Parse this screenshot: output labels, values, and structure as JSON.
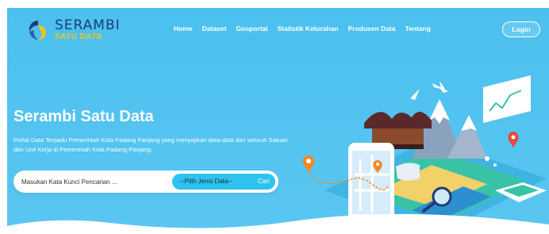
{
  "brand": {
    "title": "SERAMBI",
    "subtitle": "SATU DATA"
  },
  "nav": [
    "Home",
    "Dataset",
    "Geoportal",
    "Statistik Kelurahan",
    "Produsen Data",
    "Tentang"
  ],
  "login_label": "Login",
  "hero": {
    "title": "Serambi Satu Data",
    "description": "Portal Data Terpadu Pemerintah Kota Padang Panjang yang menyajikan data-data dari seluruh Satuan dan Unit Kerja di Pemerintah Kota Padang Panjang."
  },
  "search": {
    "placeholder": "Masukan Kata Kunci Pencarian ...",
    "select_label": "--Pilih Jenis Data--",
    "button_label": "Cari"
  },
  "colors": {
    "hero_bg": "#4bc0ee",
    "select_bg": "#2ec3ee",
    "brand_blue": "#1e3c78",
    "brand_yellow": "#f7c21b"
  }
}
